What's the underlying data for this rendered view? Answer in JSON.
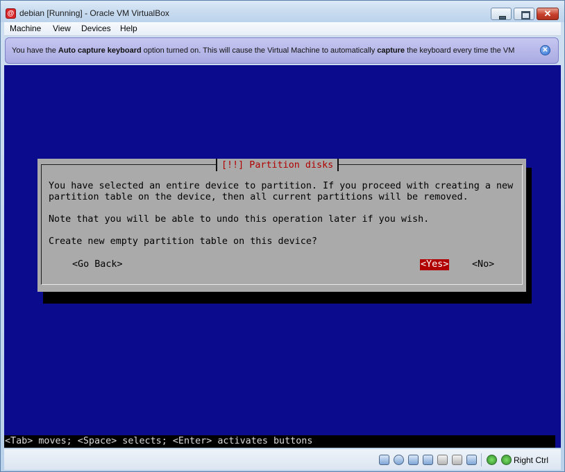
{
  "window": {
    "title": "debian [Running] - Oracle VM VirtualBox"
  },
  "menubar": {
    "items": [
      "Machine",
      "View",
      "Devices",
      "Help"
    ]
  },
  "notification": {
    "part1": "You have the ",
    "bold1": "Auto capture keyboard",
    "part2": " option turned on. This will cause the Virtual Machine to automatically ",
    "bold2": "capture",
    "part3": " the keyboard every time the VM"
  },
  "installer": {
    "dialog_title": "[!!] Partition disks",
    "lines": [
      "You have selected an entire device to partition. If you proceed with creating a new",
      "partition table on the device, then all current partitions will be removed.",
      "Note that you will be able to undo this operation later if you wish.",
      "Create new empty partition table on this device?"
    ],
    "buttons": {
      "go_back": "<Go Back>",
      "yes": "<Yes>",
      "no": "<No>"
    },
    "selected_button": "yes",
    "help_line": "<Tab> moves; <Space> selects; <Enter> activates buttons"
  },
  "statusbar": {
    "host_key": "Right Ctrl"
  },
  "colors": {
    "screen_bg": "#0b0b8e",
    "dialog_bg": "#aaaaaa",
    "dialog_title": "#b00000",
    "selected_button_bg": "#b00000"
  }
}
